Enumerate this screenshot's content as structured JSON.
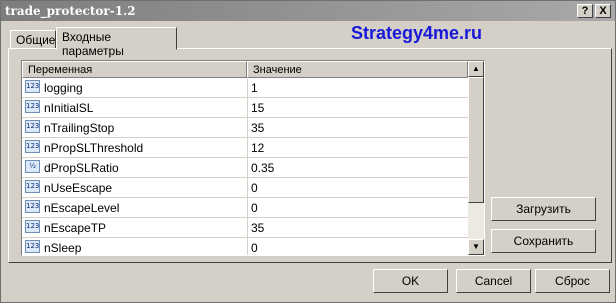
{
  "window": {
    "title": "trade_protector-1.2",
    "help_label": "?",
    "close_label": "X"
  },
  "tabs": [
    {
      "label": "Общие"
    },
    {
      "label": "Входные параметры"
    }
  ],
  "brand": "Strategy4me.ru",
  "table": {
    "columns": [
      "Переменная",
      "Значение"
    ],
    "rows": [
      {
        "icon": "123",
        "name": "logging",
        "value": "1"
      },
      {
        "icon": "123",
        "name": "nInitialSL",
        "value": "15"
      },
      {
        "icon": "123",
        "name": "nTrailingStop",
        "value": "35"
      },
      {
        "icon": "123",
        "name": "nPropSLThreshold",
        "value": "12"
      },
      {
        "icon": "v2",
        "name": "dPropSLRatio",
        "value": "0.35"
      },
      {
        "icon": "123",
        "name": "nUseEscape",
        "value": "0"
      },
      {
        "icon": "123",
        "name": "nEscapeLevel",
        "value": "0"
      },
      {
        "icon": "123",
        "name": "nEscapeTP",
        "value": "35"
      },
      {
        "icon": "123",
        "name": "nSleep",
        "value": "0"
      }
    ]
  },
  "side_buttons": {
    "load": "Загрузить",
    "save": "Сохранить"
  },
  "footer_buttons": {
    "ok": "OK",
    "cancel": "Cancel",
    "reset": "Сброс"
  },
  "colors": {
    "brand": "#1818d8",
    "titlebar": "#7d7d7d"
  }
}
